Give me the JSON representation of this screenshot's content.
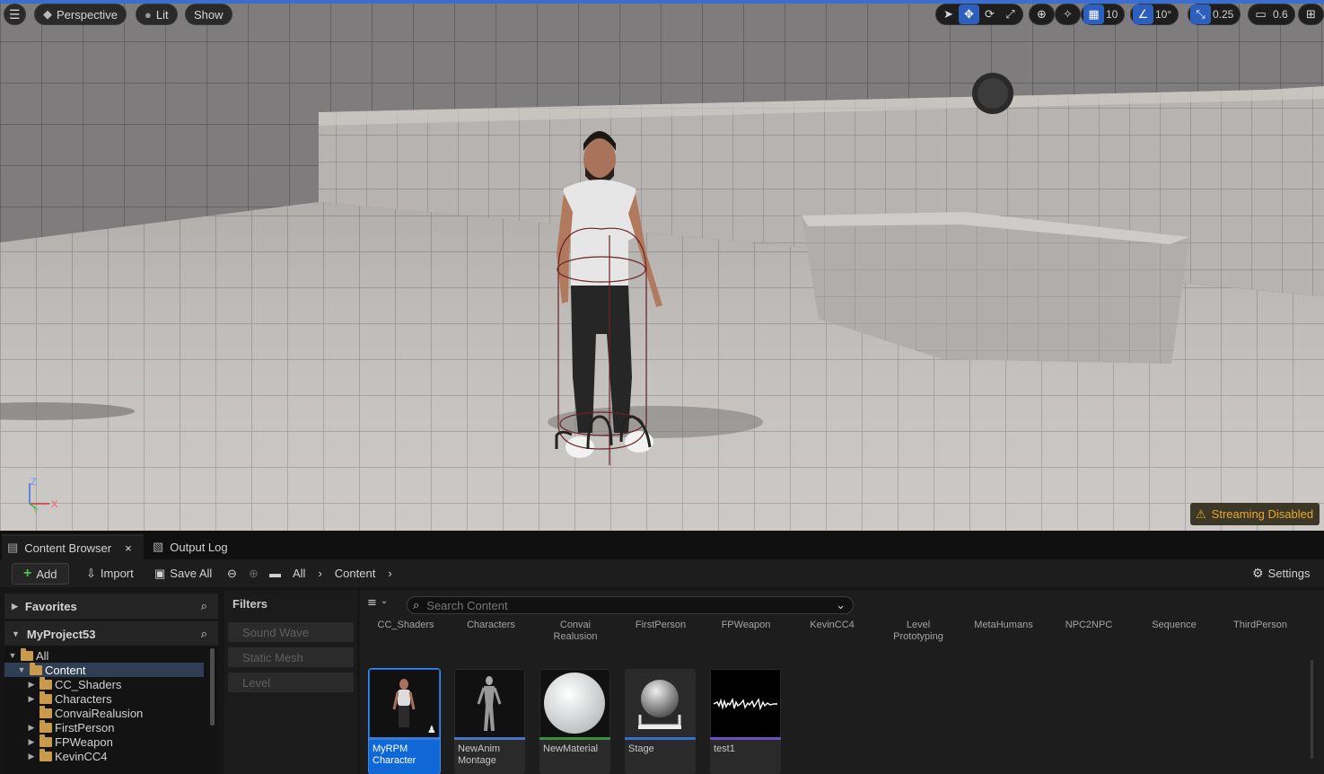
{
  "viewport": {
    "menu_icon": "hamburger-icon",
    "view_mode": "Perspective",
    "lighting": "Lit",
    "show": "Show",
    "grid_snap": "10",
    "rotation_snap": "10°",
    "scale_snap": "0.25",
    "camera_speed": "0.6",
    "streaming_warning": "Streaming Disabled",
    "axis": {
      "z": "Z",
      "x": "X",
      "y": "Y"
    }
  },
  "tabs": [
    {
      "label": "Content Browser",
      "close": "×"
    },
    {
      "label": "Output Log"
    }
  ],
  "toolbar": {
    "add": "Add",
    "import": "Import",
    "save_all": "Save All",
    "breadcrumb": [
      "All",
      "Content"
    ],
    "settings": "Settings"
  },
  "sidebar": {
    "favorites": "Favorites",
    "project": "MyProject53",
    "tree": [
      {
        "label": "All",
        "level": 0,
        "expanded": true
      },
      {
        "label": "Content",
        "level": 1,
        "expanded": true,
        "selected": true
      },
      {
        "label": "CC_Shaders",
        "level": 2
      },
      {
        "label": "Characters",
        "level": 2
      },
      {
        "label": "ConvaiRealusion",
        "level": 2
      },
      {
        "label": "FirstPerson",
        "level": 2
      },
      {
        "label": "FPWeapon",
        "level": 2
      },
      {
        "label": "KevinCC4",
        "level": 2
      }
    ]
  },
  "filters": {
    "title": "Filters",
    "items": [
      "Sound Wave",
      "Static Mesh",
      "Level"
    ]
  },
  "content": {
    "search_placeholder": "Search Content",
    "folders": [
      {
        "line1": "CC_Shaders",
        "line2": ""
      },
      {
        "line1": "Characters",
        "line2": ""
      },
      {
        "line1": "Convai",
        "line2": "Realusion"
      },
      {
        "line1": "FirstPerson",
        "line2": ""
      },
      {
        "line1": "FPWeapon",
        "line2": ""
      },
      {
        "line1": "KevinCC4",
        "line2": ""
      },
      {
        "line1": "Level",
        "line2": "Prototyping"
      },
      {
        "line1": "MetaHumans",
        "line2": ""
      },
      {
        "line1": "NPC2NPC",
        "line2": ""
      },
      {
        "line1": "Sequence",
        "line2": ""
      },
      {
        "line1": "ThirdPerson",
        "line2": ""
      }
    ],
    "assets": [
      {
        "line1": "MyRPM",
        "line2": "Character",
        "color": "#3a7bd5",
        "selected": true
      },
      {
        "line1": "NewAnim",
        "line2": "Montage",
        "color": "#4a74c4"
      },
      {
        "line1": "NewMaterial",
        "line2": "",
        "color": "#3c8f3c"
      },
      {
        "line1": "Stage",
        "line2": "",
        "color": "#3570c8"
      },
      {
        "line1": "test1",
        "line2": "",
        "color": "#6a4fc0"
      }
    ]
  }
}
